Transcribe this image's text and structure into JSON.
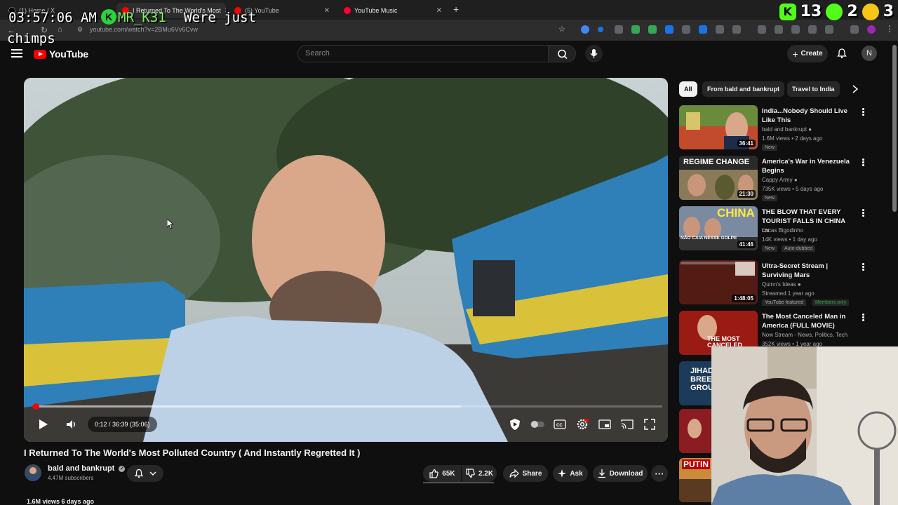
{
  "browser": {
    "tabs": [
      {
        "title": "(1) Home / X",
        "active": false
      },
      {
        "title": "I Returned To The World's Most",
        "active": true
      },
      {
        "title": "(5) YouTube",
        "active": false
      },
      {
        "title": "YouTube Music",
        "active": false
      }
    ],
    "new_tab": "+",
    "url": "youtube.com/watch?v=2BMu6Vv6Cvw"
  },
  "stream_overlay": {
    "clock": "03:57:06 AM",
    "chatter": "MR_K31",
    "k_badge": "K",
    "message_line1": "Were just",
    "message_line2": "chimps",
    "stats": [
      {
        "icon": "kick-icon",
        "color": "#53fc18",
        "value": "13"
      },
      {
        "icon": "play-icon",
        "color": "#53fc18",
        "value": "2"
      },
      {
        "icon": "viewer-icon",
        "color": "#f5c518",
        "value": "3"
      }
    ]
  },
  "header": {
    "logo_text": "YouTube",
    "search_placeholder": "Search",
    "create_label": "Create",
    "avatar_letter": "N"
  },
  "player": {
    "time_display": "0:12 / 36:39 (35:06)",
    "progress_fraction": 0.006,
    "buffer_fraction": 0.68
  },
  "video": {
    "title": "I Returned To The World's Most Polluted Country ( And Instantly Regretted It )",
    "channel": "bald and bankrupt",
    "subscribers": "4.47M subscribers",
    "likes": "65K",
    "dislikes": "2.2K",
    "share_label": "Share",
    "ask_label": "Ask",
    "download_label": "Download",
    "views_line": "1.6M views  6 days ago"
  },
  "sidebar": {
    "chips": [
      "All",
      "From bald and bankrupt",
      "Travel to India"
    ],
    "recommendations": [
      {
        "title": "India...Nobody Should Live Like This",
        "channel": "bald and bankrupt",
        "meta": "1.6M views • 2 days ago",
        "duration": "36:41",
        "badge": "New",
        "verified": true
      },
      {
        "title": "America's War in Venezuela Begins",
        "channel": "Cappy Army",
        "meta": "735K views • 5 days ago",
        "duration": "21:30",
        "badge": "New",
        "verified": true,
        "thumb_text": "REGIME CHANGE"
      },
      {
        "title": "THE BLOW THAT EVERY TOURIST FALLS IN CHINA",
        "title_suffix": "CN",
        "channel": "Lucas Bigodinho",
        "meta": "14K views • 1 day ago",
        "duration": "41:46",
        "badge": "New",
        "badge2": "Auto-dubbed",
        "thumb_text": "CHINA",
        "thumb_sub": "NÃO CAIA NESSE GOLPE"
      },
      {
        "title": "Ultra-Secret Stream | Surviving Mars",
        "channel": "Quinn's Ideas",
        "meta": "Streamed 1 year ago",
        "duration": "1:48:05",
        "badge": "YouTube featured",
        "badge2": "Members only",
        "verified": true
      },
      {
        "title": "The Most Canceled Man in America (FULL MOVIE)",
        "channel": "Now Stream - News, Politics, Tech",
        "meta": "352K views • 1 year ago",
        "thumb_text": "THE MOST CANCELED"
      },
      {
        "title": "",
        "channel": "",
        "meta": "",
        "thumb_text": "JIHADI BREED GROU"
      },
      {
        "title": "",
        "channel": "",
        "meta": ""
      },
      {
        "title": "",
        "channel": "",
        "meta": "",
        "thumb_text": "PUTIN"
      }
    ]
  }
}
